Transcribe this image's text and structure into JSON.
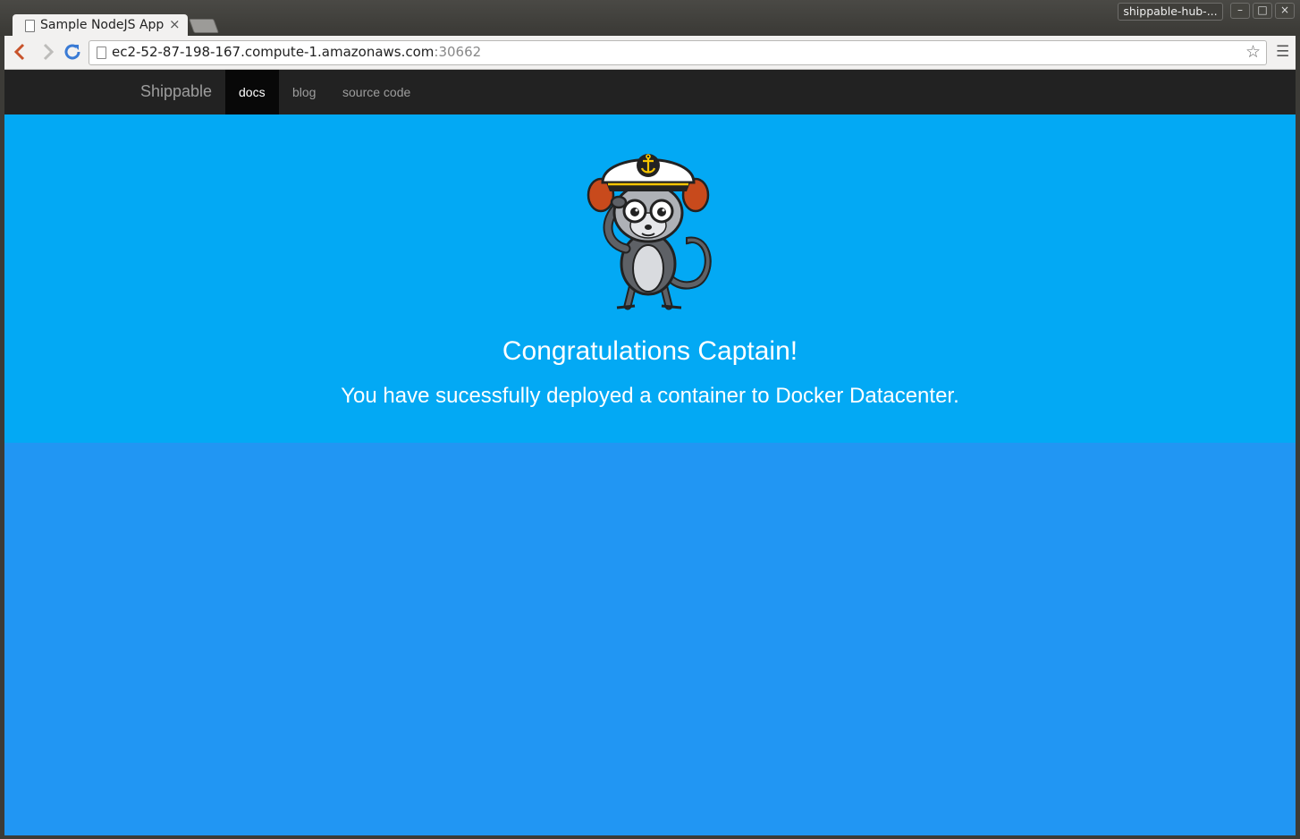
{
  "browser": {
    "tab_title": "Sample NodeJS App",
    "tab_close": "×",
    "profile_label": "shippable-hub-...",
    "window_buttons": {
      "minimize": "–",
      "maximize": "□",
      "close": "×"
    },
    "url": {
      "host": "ec2-52-87-198-167.compute-1.amazonaws.com",
      "port": ":30662"
    },
    "icons": {
      "back": "chevron-left-icon",
      "forward": "chevron-right-icon",
      "reload": "reload-icon",
      "bookmark": "star-icon",
      "menu": "hamburger-menu-icon"
    }
  },
  "navbar": {
    "brand": "Shippable",
    "items": [
      {
        "label": "docs",
        "active": true
      },
      {
        "label": "blog",
        "active": false
      },
      {
        "label": "source code",
        "active": false
      }
    ]
  },
  "hero": {
    "title": "Congratulations Captain!",
    "subtitle": "You have sucessfully deployed a container to Docker Datacenter."
  },
  "colors": {
    "navbar_bg": "#222222",
    "hero_bg": "#03a9f4",
    "page_bg": "#2196f3",
    "nav_active_bg": "#080808"
  }
}
